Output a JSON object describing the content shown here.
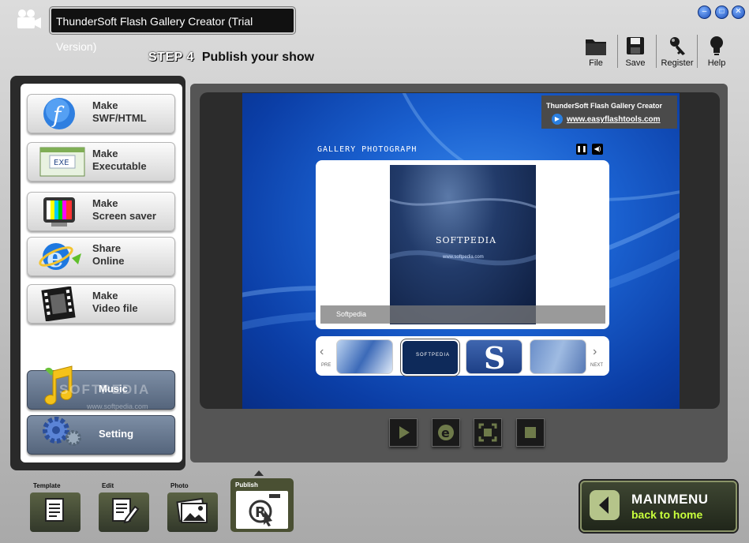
{
  "window": {
    "title": "ThunderSoft Flash Gallery Creator (Trial Version)",
    "controls": [
      "minimize",
      "maximize",
      "close"
    ]
  },
  "step": {
    "number": "STEP 4",
    "title": "Publish your show"
  },
  "toolbar": [
    {
      "label": "File",
      "icon": "folder-icon"
    },
    {
      "label": "Save",
      "icon": "floppy-icon"
    },
    {
      "label": "Register",
      "icon": "key-icon"
    },
    {
      "label": "Help",
      "icon": "bulb-icon"
    }
  ],
  "publish_options": [
    {
      "line1": "Make",
      "line2": "SWF/HTML"
    },
    {
      "line1": "Make",
      "line2": "Executable",
      "icon_text": "EXE"
    },
    {
      "line1": "Make",
      "line2": "Screen saver"
    },
    {
      "line1": "Share",
      "line2": "Online"
    },
    {
      "line1": "Make",
      "line2": "Video file"
    }
  ],
  "side_buttons": {
    "music": "Music",
    "setting": "Setting"
  },
  "preview": {
    "brand_name": "ThunderSoft Flash Gallery Creator",
    "brand_url": "www.easyflashtools.com",
    "gallery_title": "GALLERY PHOTOGRAPH",
    "photo_brand": "SOFTPEDIA",
    "photo_url": "www.softpedia.com",
    "caption": "Softpedia",
    "prev_label": "PRE",
    "next_label": "NEXT",
    "watermark": "SOFTPEDIA",
    "watermark_url": "www.softpedia.com"
  },
  "player_controls": [
    "play-icon",
    "ie-icon",
    "fullscreen-icon",
    "stop-icon"
  ],
  "tabs": [
    {
      "label": "Template",
      "icon": "document-icon"
    },
    {
      "label": "Edit",
      "icon": "edit-icon"
    },
    {
      "label": "Photo",
      "icon": "photo-icon"
    },
    {
      "label": "Publish",
      "icon": "publish-icon",
      "active": true
    }
  ],
  "main_menu": {
    "line1": "MAINMENU",
    "line2": "back to home"
  },
  "colors": {
    "accent_green": "#c8ff3c",
    "stage_blue": "#1a60cf"
  }
}
